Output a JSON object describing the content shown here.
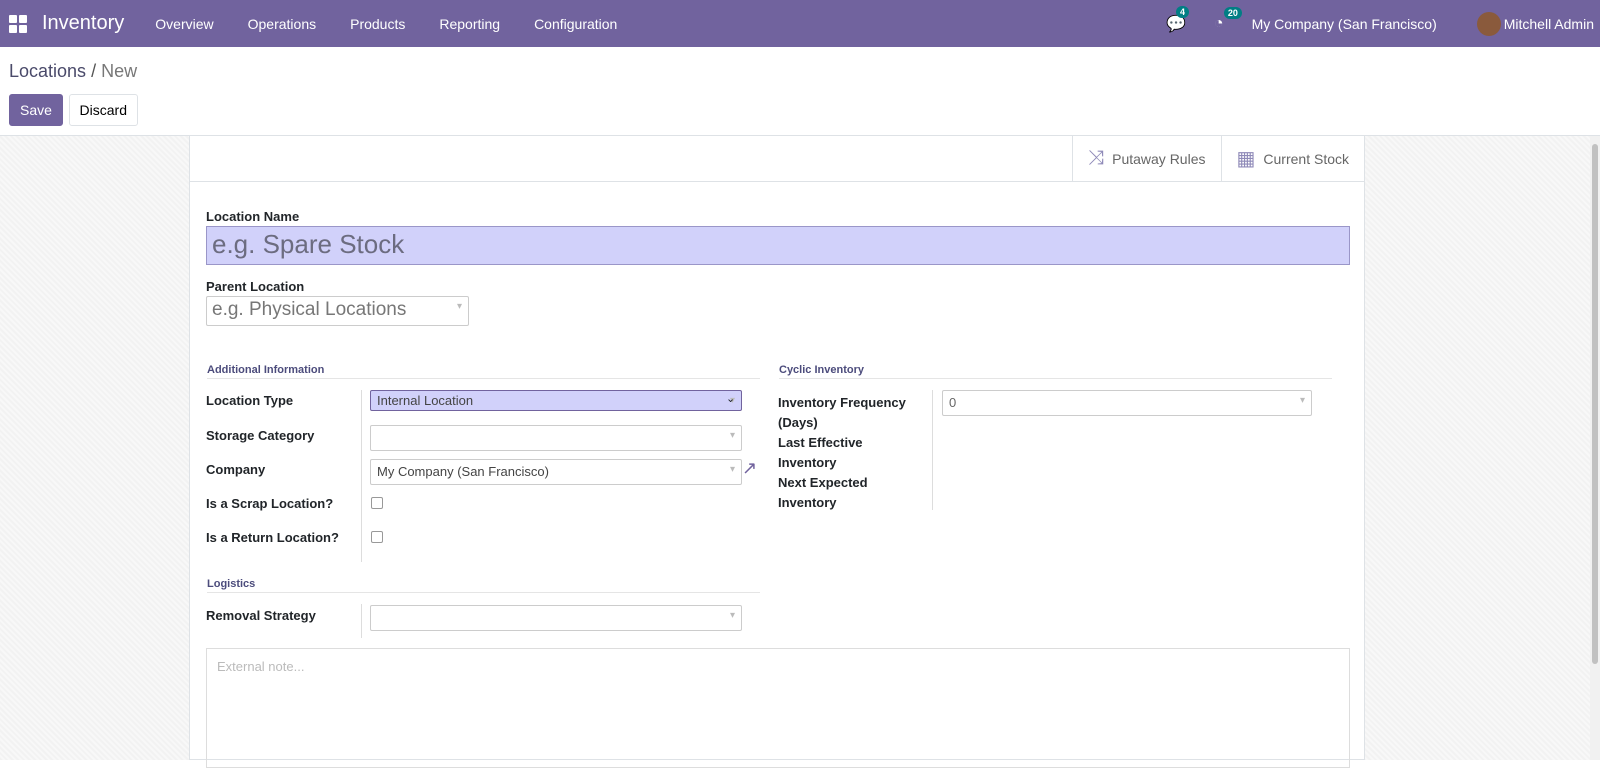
{
  "nav": {
    "app": "Inventory",
    "menus": [
      "Overview",
      "Operations",
      "Products",
      "Reporting",
      "Configuration"
    ],
    "messages_count": "4",
    "activity_count": "20",
    "company": "My Company (San Francisco)",
    "user": "Mitchell Admin"
  },
  "breadcrumb": {
    "parent": "Locations",
    "current": "New"
  },
  "buttons": {
    "save": "Save",
    "discard": "Discard"
  },
  "smart_buttons": {
    "putaway": "Putaway Rules",
    "stock": "Current Stock"
  },
  "form": {
    "name_label": "Location Name",
    "name_placeholder": "e.g. Spare Stock",
    "parent_label": "Parent Location",
    "parent_placeholder": "e.g. Physical Locations",
    "additional": "Additional Information",
    "location_type_label": "Location Type",
    "location_type": "Internal Location",
    "storage_label": "Storage Category",
    "company_label": "Company",
    "company": "My Company (San Francisco)",
    "scrap_label": "Is a Scrap Location?",
    "return_label": "Is a Return Location?",
    "cyclic": "Cyclic Inventory",
    "freq_label": "Inventory Frequency (Days)",
    "freq": "0",
    "last_label": "Last Effective Inventory",
    "next_label": "Next Expected Inventory",
    "logistics": "Logistics",
    "removal_label": "Removal Strategy",
    "note_placeholder": "External note..."
  }
}
